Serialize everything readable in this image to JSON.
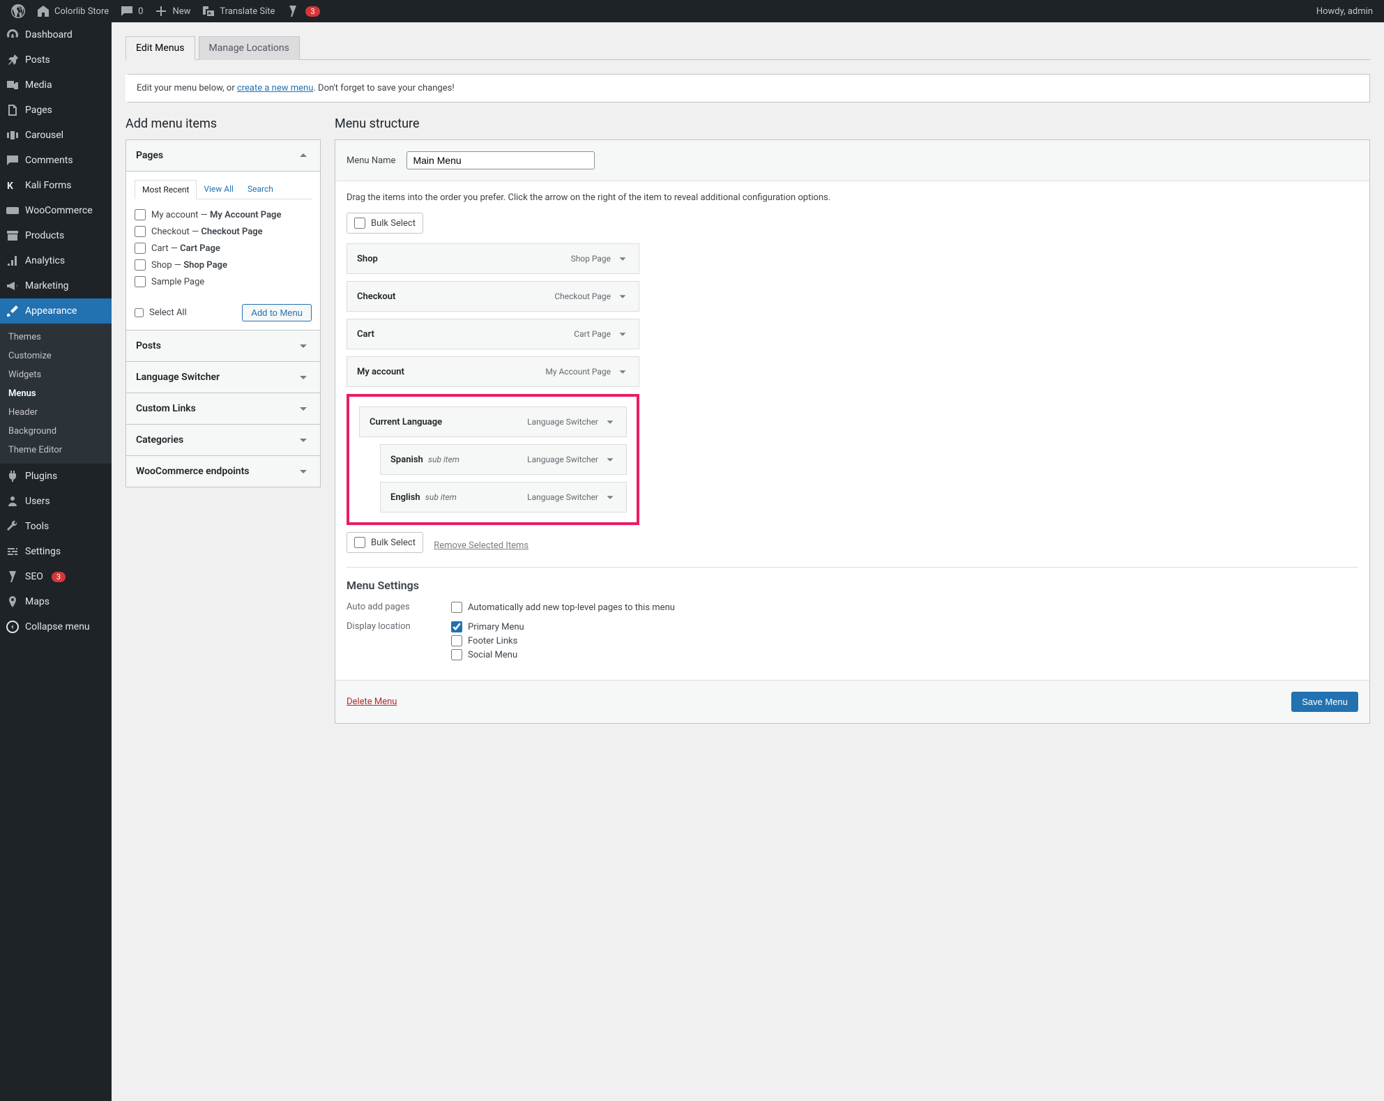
{
  "adminbar": {
    "site_name": "Colorlib Store",
    "comments": "0",
    "new": "New",
    "translate": "Translate Site",
    "yoast_count": "3",
    "howdy": "Howdy, admin"
  },
  "sidebar": {
    "items": [
      {
        "label": "Dashboard"
      },
      {
        "label": "Posts"
      },
      {
        "label": "Media"
      },
      {
        "label": "Pages"
      },
      {
        "label": "Carousel"
      },
      {
        "label": "Comments"
      },
      {
        "label": "Kali Forms"
      },
      {
        "label": "WooCommerce"
      },
      {
        "label": "Products"
      },
      {
        "label": "Analytics"
      },
      {
        "label": "Marketing"
      },
      {
        "label": "Appearance"
      },
      {
        "label": "Plugins"
      },
      {
        "label": "Users"
      },
      {
        "label": "Tools"
      },
      {
        "label": "Settings"
      },
      {
        "label": "SEO"
      },
      {
        "label": "Maps"
      },
      {
        "label": "Collapse menu"
      }
    ],
    "seo_count": "3",
    "submenu": [
      {
        "label": "Themes"
      },
      {
        "label": "Customize"
      },
      {
        "label": "Widgets"
      },
      {
        "label": "Menus"
      },
      {
        "label": "Header"
      },
      {
        "label": "Background"
      },
      {
        "label": "Theme Editor"
      }
    ]
  },
  "tabs": {
    "edit": "Edit Menus",
    "manage": "Manage Locations"
  },
  "notice": {
    "pre": "Edit your menu below, or ",
    "link": "create a new menu",
    "post": ". Don't forget to save your changes!"
  },
  "left": {
    "heading": "Add menu items",
    "pages": {
      "title": "Pages",
      "tabs": {
        "recent": "Most Recent",
        "all": "View All",
        "search": "Search"
      },
      "items": [
        {
          "pre": "My account — ",
          "strong": "My Account Page"
        },
        {
          "pre": "Checkout — ",
          "strong": "Checkout Page"
        },
        {
          "pre": "Cart — ",
          "strong": "Cart Page"
        },
        {
          "pre": "Shop — ",
          "strong": "Shop Page"
        },
        {
          "pre": "Sample Page",
          "strong": ""
        }
      ],
      "select_all": "Select All",
      "add": "Add to Menu"
    },
    "sections": [
      "Posts",
      "Language Switcher",
      "Custom Links",
      "Categories",
      "WooCommerce endpoints"
    ]
  },
  "right": {
    "heading": "Menu structure",
    "name_label": "Menu Name",
    "name_value": "Main Menu",
    "instructions": "Drag the items into the order you prefer. Click the arrow on the right of the item to reveal additional configuration options.",
    "bulk": "Bulk Select",
    "items": [
      {
        "title": "Shop",
        "type": "Shop Page"
      },
      {
        "title": "Checkout",
        "type": "Checkout Page"
      },
      {
        "title": "Cart",
        "type": "Cart Page"
      },
      {
        "title": "My account",
        "type": "My Account Page"
      }
    ],
    "highlight": {
      "parent": {
        "title": "Current Language",
        "type": "Language Switcher"
      },
      "children": [
        {
          "title": "Spanish",
          "sub": "sub item",
          "type": "Language Switcher"
        },
        {
          "title": "English",
          "sub": "sub item",
          "type": "Language Switcher"
        }
      ]
    },
    "remove": "Remove Selected Items",
    "settings": {
      "heading": "Menu Settings",
      "auto_label": "Auto add pages",
      "auto_text": "Automatically add new top-level pages to this menu",
      "display_label": "Display location",
      "locations": [
        "Primary Menu",
        "Footer Links",
        "Social Menu"
      ]
    },
    "delete": "Delete Menu",
    "save": "Save Menu"
  }
}
